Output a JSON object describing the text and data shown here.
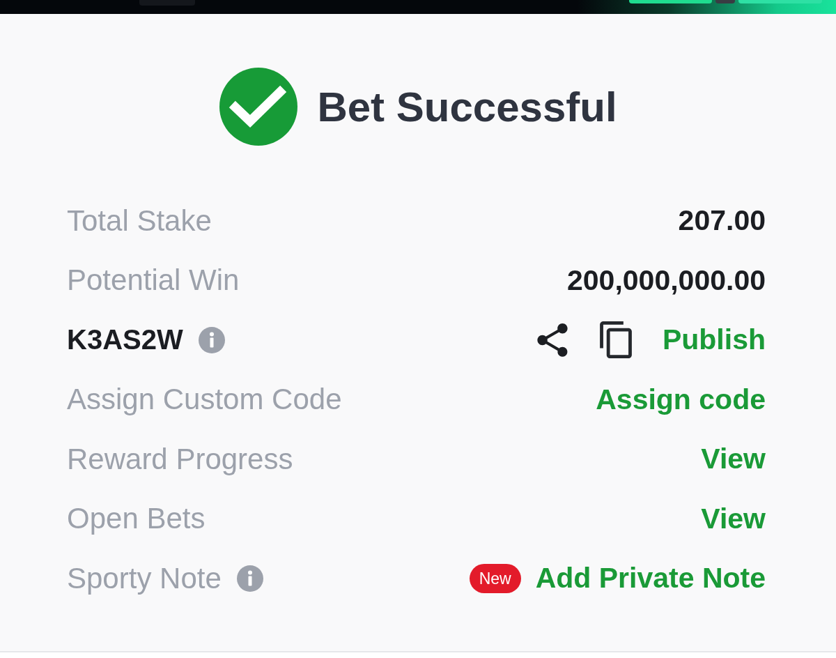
{
  "status": {
    "title": "Bet Successful"
  },
  "rows": [
    {
      "kind": "amount",
      "label": "Total Stake",
      "value": "207.00"
    },
    {
      "kind": "amount",
      "label": "Potential Win",
      "value": "200,000,000.00"
    },
    {
      "kind": "code",
      "code": "K3AS2W",
      "action": "Publish"
    },
    {
      "kind": "link",
      "label": "Assign Custom Code",
      "action": "Assign code"
    },
    {
      "kind": "link",
      "label": "Reward Progress",
      "action": "View"
    },
    {
      "kind": "link",
      "label": "Open Bets",
      "action": "View"
    },
    {
      "kind": "note",
      "label": "Sporty Note",
      "badge": "New",
      "action": "Add Private Note"
    }
  ]
}
